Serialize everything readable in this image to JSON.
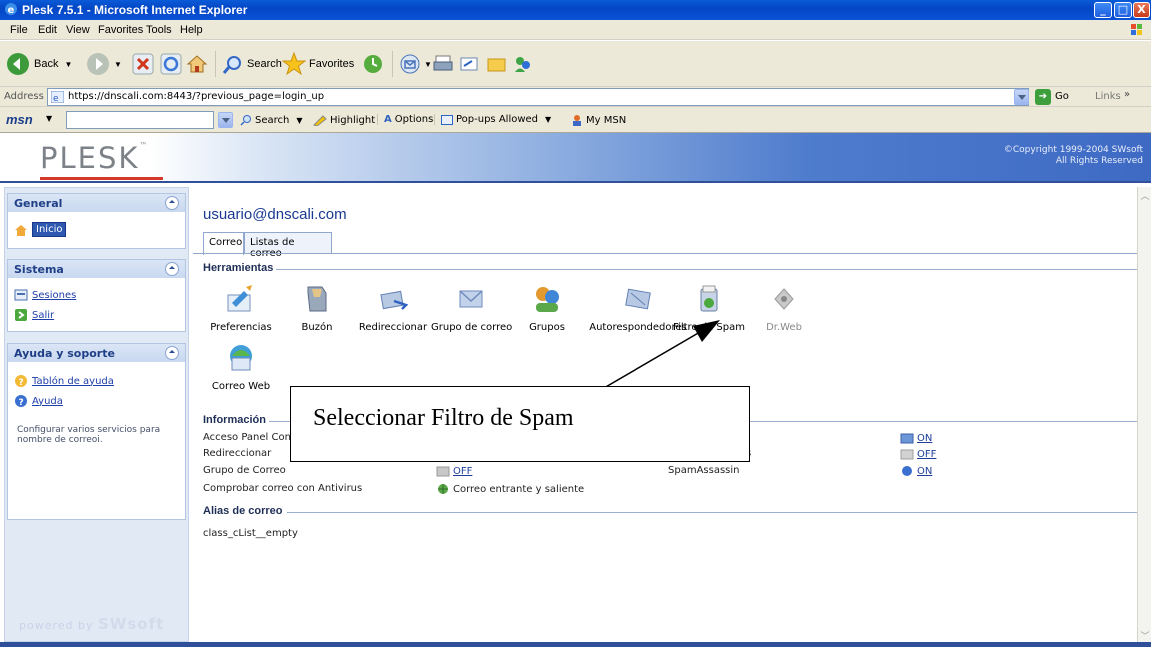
{
  "window": {
    "title": "Plesk 7.5.1 - Microsoft Internet Explorer",
    "buttons": [
      "_",
      "□",
      "X"
    ]
  },
  "menu": [
    "File",
    "Edit",
    "View",
    "Favorites",
    "Tools",
    "Help"
  ],
  "toolbar": {
    "back": "Back",
    "search": "Search",
    "favorites": "Favorites"
  },
  "address": {
    "label": "Address",
    "url": "https://dnscali.com:8443/?previous_page=login_up",
    "go": "Go",
    "links": "Links"
  },
  "msn": {
    "logo": "msn",
    "search": "Search",
    "highlight": "Highlight",
    "options": "Options",
    "popups": "Pop-ups Allowed",
    "mymsn": "My MSN"
  },
  "header": {
    "logo": "PLESK",
    "tm": "™",
    "copyright_line1": "©Copyright 1999-2004 SWsoft",
    "copyright_line2": "All Rights Reserved"
  },
  "sidebar": {
    "general": {
      "title": "General",
      "items": [
        {
          "label": "Inicio"
        }
      ]
    },
    "sistema": {
      "title": "Sistema",
      "items": [
        {
          "label": "Sesiones"
        },
        {
          "label": "Salir"
        }
      ]
    },
    "ayuda": {
      "title": "Ayuda y soporte",
      "items": [
        {
          "label": "Tablón de ayuda"
        },
        {
          "label": "Ayuda"
        }
      ]
    },
    "description": "Configurar varios servicios para nombre de correoi.",
    "powered_prefix": "powered by",
    "powered_brand": "SWsoft"
  },
  "main": {
    "user": "usuario@dnscali.com",
    "tabs": [
      "Correo",
      "Listas de correo"
    ],
    "tools_title": "Herramientas",
    "tools": [
      {
        "label": "Preferencias",
        "icon": "preferences-icon"
      },
      {
        "label": "Buzón",
        "icon": "mailbox-icon"
      },
      {
        "label": "Redireccionar",
        "icon": "redirect-icon"
      },
      {
        "label": "Grupo de correo",
        "icon": "mail-group-icon"
      },
      {
        "label": "Grupos",
        "icon": "groups-icon"
      },
      {
        "label": "Autorespondedores",
        "icon": "autoresponder-icon"
      },
      {
        "label": "Filtro de Spam",
        "icon": "spam-filter-icon"
      },
      {
        "label": "Dr.Web",
        "icon": "drweb-icon"
      },
      {
        "label": "Correo Web",
        "icon": "webmail-icon"
      }
    ],
    "info_title": "Información",
    "info_rows": [
      {
        "label": "Acceso Panel Contro"
      },
      {
        "label": "Redireccionar"
      },
      {
        "label": "Grupo de Correo",
        "value": "OFF"
      },
      {
        "label": "Comprobar correo con Antivirus",
        "value": "Correo entrante y saliente"
      }
    ],
    "info_right_label": "SpamAssassin",
    "info_right_partial": "s",
    "status": [
      "ON",
      "OFF",
      "ON"
    ],
    "alias_title": "Alias de correo",
    "alias_value": "class_cList__empty"
  },
  "annotation": {
    "text": "Seleccionar Filtro de Spam"
  }
}
